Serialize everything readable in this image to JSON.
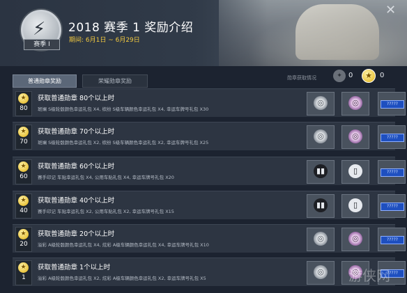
{
  "header": {
    "title": "2018 赛季 1 奖励介绍",
    "subtitle": "期间: 6月1日 ~ 6月29日",
    "badge_label": "赛季 I",
    "close_icon": "close-icon"
  },
  "tabs": [
    {
      "label": "普通勋章奖励",
      "active": true
    },
    {
      "label": "荣耀勋章奖励",
      "active": false
    }
  ],
  "medals": {
    "label": "勋章获取情况",
    "honor_count": "0",
    "normal_count": "0"
  },
  "rows": [
    {
      "rank": "80",
      "title": "获取普通勋章 80个以上时",
      "desc": "斑斓 S级轮毂颜色幸运礼包 X4, 缤纷 S级车辆颜色幸运礼包 X4, 幸运车牌号礼包 X30",
      "rewards": [
        "wheel",
        "wheel-purple",
        "plate"
      ]
    },
    {
      "rank": "70",
      "title": "获取普通勋章 70个以上时",
      "desc": "斑斓 S级轮毂颜色幸运礼包 X2, 缤纷 S级车辆颜色幸运礼包 X2, 幸运车牌号礼包 X25",
      "rewards": [
        "wheel",
        "wheel-purple",
        "plate"
      ]
    },
    {
      "rank": "60",
      "title": "获取普通勋章 60个以上时",
      "desc": "赛手印记 车贴幸运礼包 X4, 公用车贴礼包 X4, 幸运车牌号礼包 X20",
      "rewards": [
        "decal",
        "decal-light",
        "plate"
      ]
    },
    {
      "rank": "40",
      "title": "获取普通勋章 40个以上时",
      "desc": "赛手印记 车贴幸运礼包 X2, 公用车贴礼包 X2, 幸运车牌号礼包 X15",
      "rewards": [
        "decal",
        "decal-light",
        "plate"
      ]
    },
    {
      "rank": "20",
      "title": "获取普通勋章 20个以上时",
      "desc": "溢彩 A级轮毂颜色幸运礼包 X4, 炫彩 A级车辆颜色幸运礼包 X4, 幸运车牌号礼包 X10",
      "rewards": [
        "wheel",
        "wheel-purple",
        "plate"
      ]
    },
    {
      "rank": "1",
      "title": "获取普通勋章 1个以上时",
      "desc": "溢彩 A级轮毂颜色幸运礼包 X2, 炫彩 A级车辆颜色幸运礼包 X2, 幸运车牌号礼包 X5",
      "rewards": [
        "wheel",
        "wheel-purple",
        "plate"
      ]
    }
  ],
  "plate_text": "?????",
  "watermark": "游侠网"
}
